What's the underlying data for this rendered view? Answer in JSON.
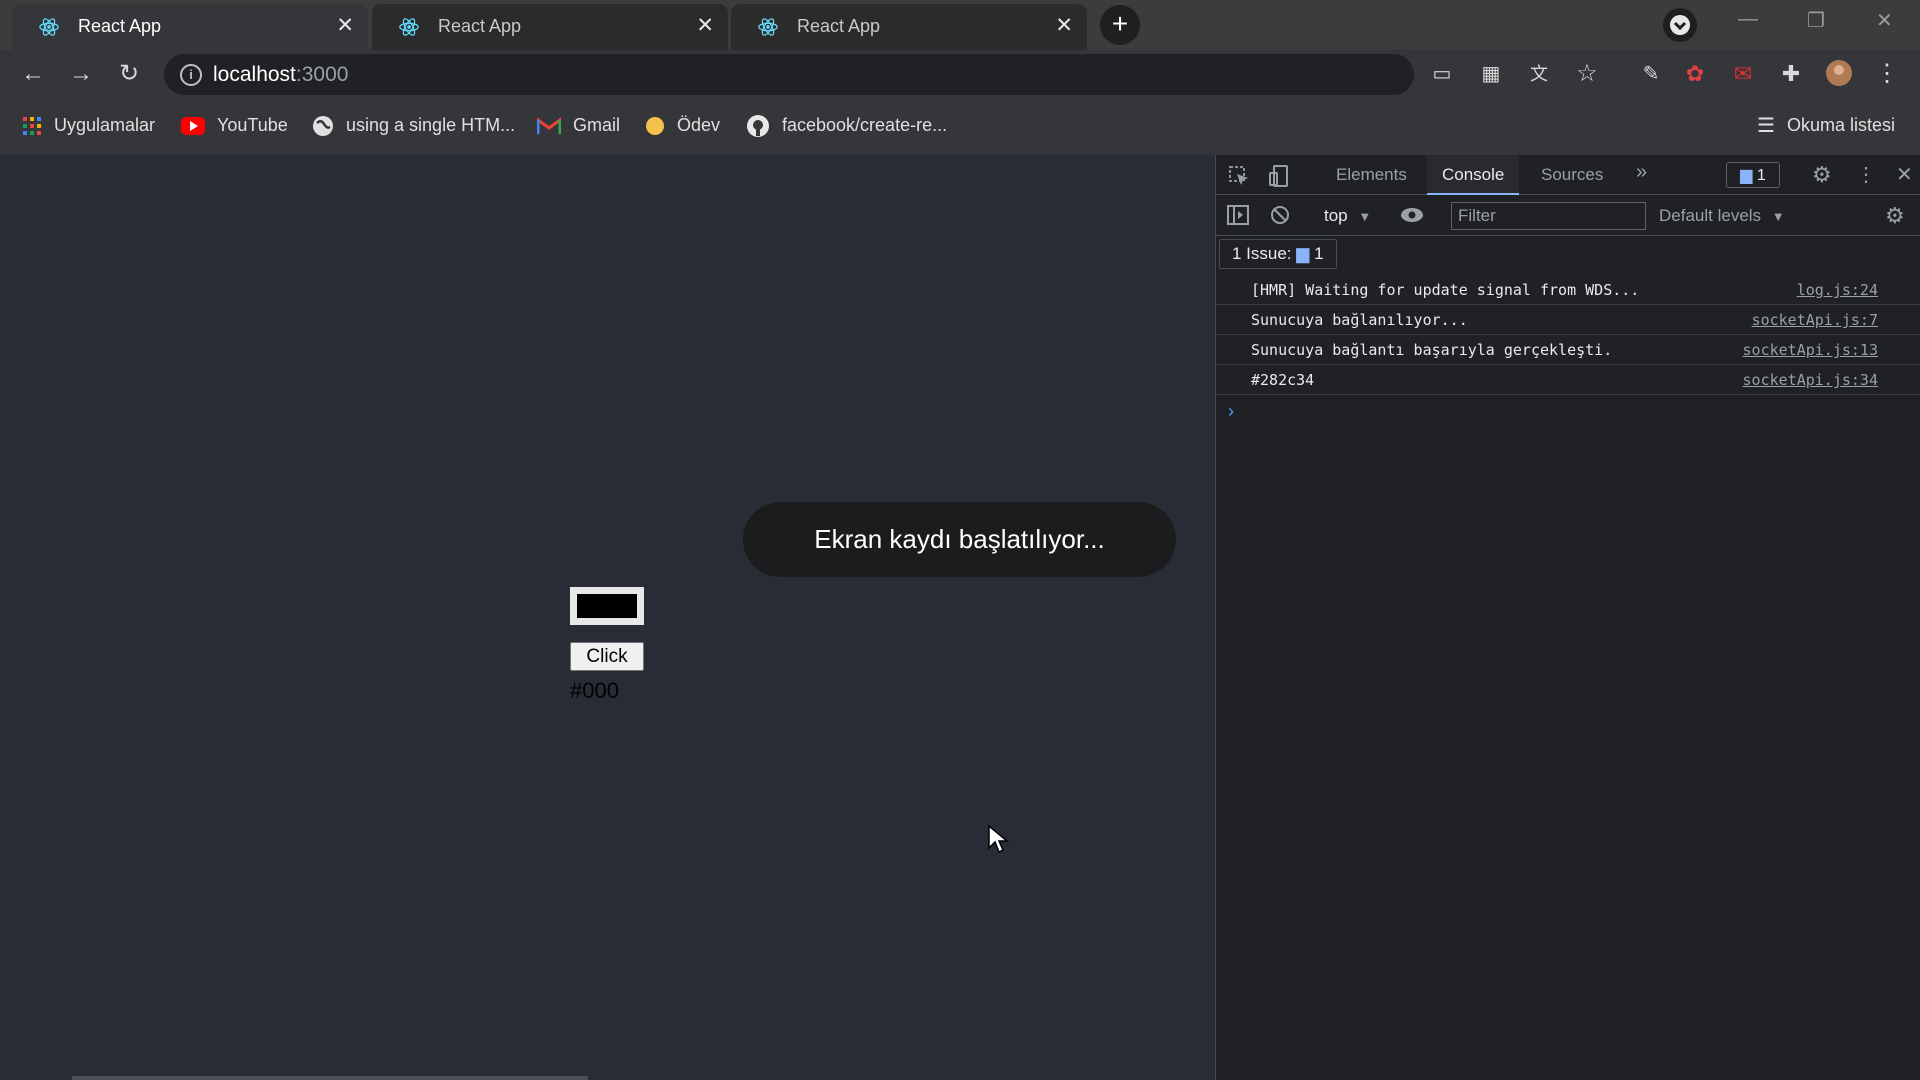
{
  "browser": {
    "tabs": [
      {
        "title": "React App",
        "active": true
      },
      {
        "title": "React App",
        "active": false
      },
      {
        "title": "React App",
        "active": false
      }
    ],
    "new_tab_icon": "plus-icon",
    "address": {
      "host": "localhost",
      "port": ":3000"
    },
    "bookmarks": [
      {
        "label": "Uygulamalar",
        "icon": "apps-grid-icon"
      },
      {
        "label": "YouTube",
        "icon": "youtube-icon"
      },
      {
        "label": "using a single HTM...",
        "icon": "globe-icon"
      },
      {
        "label": "Gmail",
        "icon": "gmail-icon"
      },
      {
        "label": "Ödev",
        "icon": "circle-folder-icon"
      },
      {
        "label": "facebook/create-re...",
        "icon": "github-icon"
      }
    ],
    "reading_list": "Okuma listesi"
  },
  "page": {
    "toast": "Ekran kaydı başlatılıyor...",
    "button_label": "Click",
    "color_value": "#000",
    "box_color": "#000000"
  },
  "devtools": {
    "tabs": [
      "Elements",
      "Console",
      "Sources"
    ],
    "active_tab": "Console",
    "issues_count": "1",
    "context": "top",
    "filter_placeholder": "Filter",
    "levels": "Default levels",
    "issue_bar": {
      "label": "1 Issue:",
      "count": "1"
    },
    "logs": [
      {
        "message": "[HMR] Waiting for update signal from WDS...",
        "source": "log.js:24"
      },
      {
        "message": "Sunucuya bağlanılıyor...",
        "source": "socketApi.js:7"
      },
      {
        "message": "Sunucuya bağlantı başarıyla gerçekleşti.",
        "source": "socketApi.js:13"
      },
      {
        "message": "#282c34",
        "source": "socketApi.js:34"
      }
    ]
  },
  "colors": {
    "page_bg": "#282c34",
    "devtools_bg": "#202124",
    "accent": "#8ab4f8"
  }
}
